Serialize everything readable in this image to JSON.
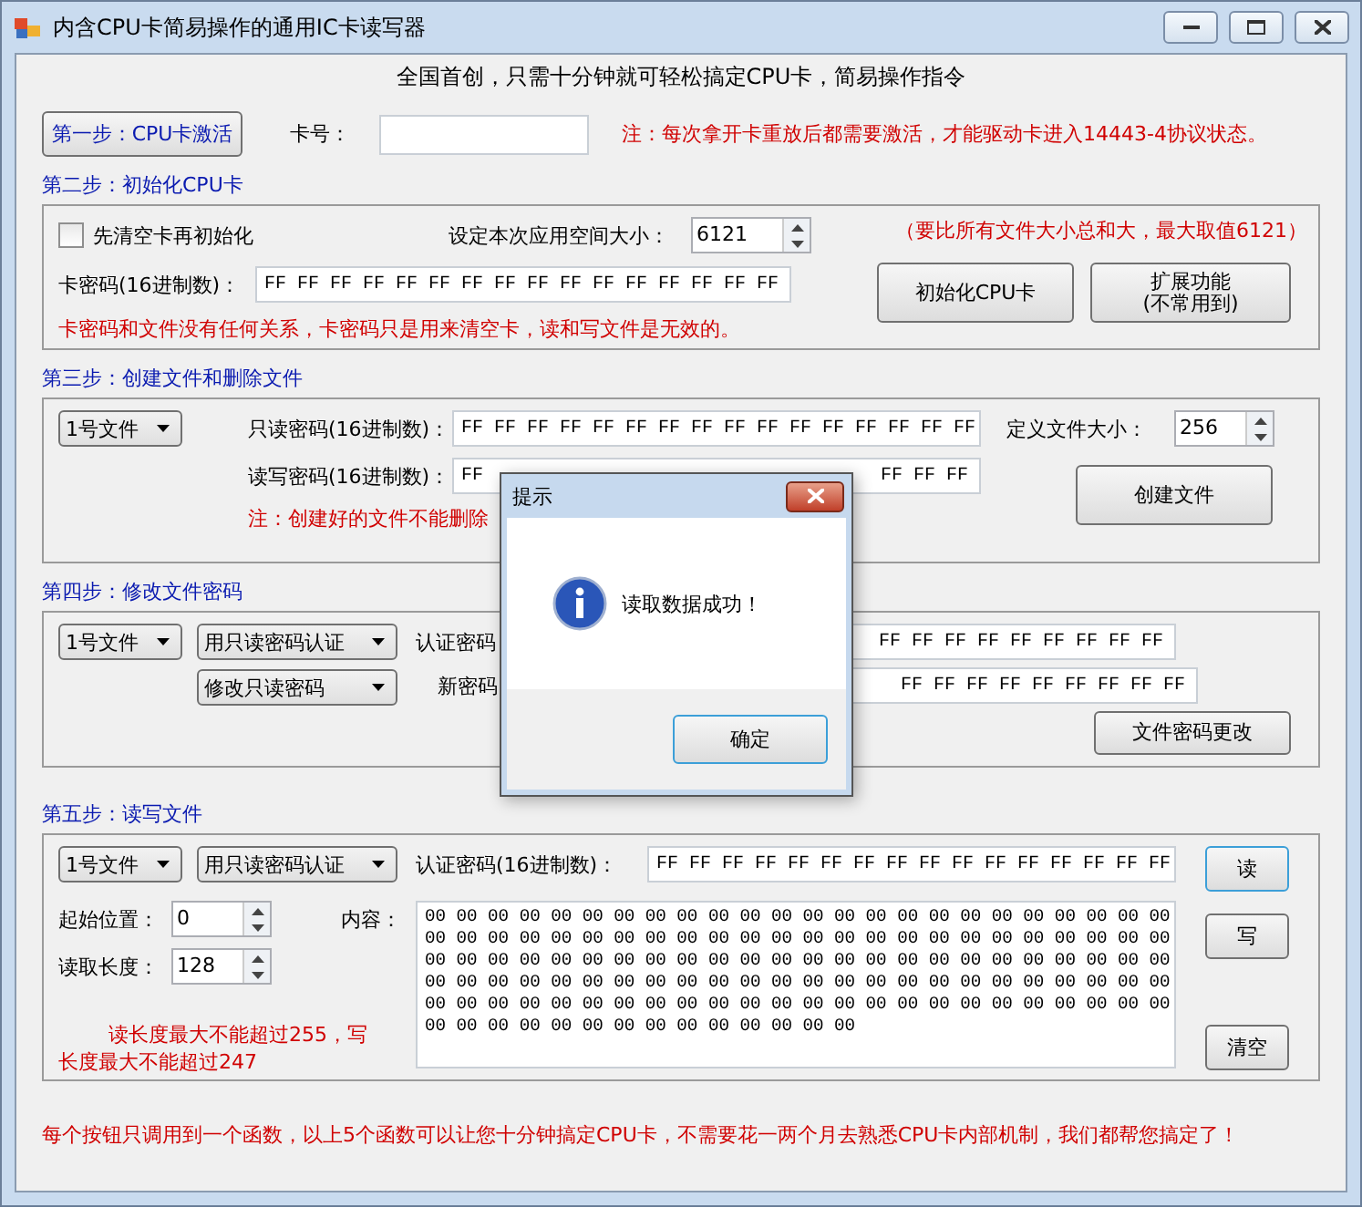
{
  "window": {
    "title": "内含CPU卡简易操作的通用IC卡读写器"
  },
  "subtitle": "全国首创，只需十分钟就可轻松搞定CPU卡，简易操作指令",
  "step1": {
    "button": "第一步：CPU卡激活",
    "card_label": "卡号：",
    "note": "注：每次拿开卡重放后都需要激活，才能驱动卡进入14443-4协议状态。"
  },
  "step2": {
    "title": "第二步：初始化CPU卡",
    "clear_checkbox": {
      "label": "先清空卡再初始化",
      "checked": false
    },
    "space_label": "设定本次应用空间大小：",
    "space_value": "6121",
    "space_note": "（要比所有文件大小总和大，最大取值6121）",
    "key_label": "卡密码(16进制数)：",
    "key_value": "FF FF FF FF FF FF FF FF FF FF FF FF FF FF FF FF",
    "note": "卡密码和文件没有任何关系，卡密码只是用来清空卡，读和写文件是无效的。",
    "init_button": "初始化CPU卡",
    "ext_button_lines": [
      "扩展功能",
      "(不常用到)"
    ]
  },
  "step3": {
    "title": "第三步：创建文件和删除文件",
    "file_select": "1号文件",
    "ro_label": "只读密码(16进制数)：",
    "ro_value": "FF FF FF FF FF FF FF FF FF FF FF FF FF FF FF FF",
    "rw_label": "读写密码(16进制数)：",
    "rw_value_start": "FF",
    "rw_value_end": "FF FF FF",
    "note": "注：创建好的文件不能删除",
    "size_label": "定义文件大小：",
    "size_value": "256",
    "button": "创建文件"
  },
  "step4": {
    "title": "第四步：修改文件密码",
    "file_select": "1号文件",
    "auth_select": "用只读密码认证",
    "target_select": "修改只读密码",
    "auth_label": "认证密码",
    "auth_value": "FF FF FF FF FF FF FF FF FF",
    "new_label": "新密码",
    "new_value": "FF FF FF FF FF FF FF FF FF",
    "button": "文件密码更改"
  },
  "step5": {
    "title": "第五步：读写文件",
    "file_select": "1号文件",
    "auth_select": "用只读密码认证",
    "auth_label": "认证密码(16进制数)：",
    "auth_value": "FF FF FF FF FF FF FF FF FF FF FF FF FF FF FF FF",
    "start_label": "起始位置：",
    "start_value": "0",
    "length_label": "读取长度：",
    "length_value": "128",
    "content_label": "内容：",
    "content": "00 00 00 00 00 00 00 00 00 00 00 00 00 00 00 00 00 00 00 00 00 00 00 00\n00 00 00 00 00 00 00 00 00 00 00 00 00 00 00 00 00 00 00 00 00 00 00 00\n00 00 00 00 00 00 00 00 00 00 00 00 00 00 00 00 00 00 00 00 00 00 00 00\n00 00 00 00 00 00 00 00 00 00 00 00 00 00 00 00 00 00 00 00 00 00 00 00\n00 00 00 00 00 00 00 00 00 00 00 00 00 00 00 00 00 00 00 00 00 00 00 00\n00 00 00 00 00 00 00 00 00 00 00 00 00 00",
    "note": "读长度最大不能超过255，写长度最大不能超过247",
    "read_button": "读",
    "write_button": "写",
    "clear_button": "清空"
  },
  "footer": "每个按钮只调用到一个函数，以上5个函数可以让您十分钟搞定CPU卡，不需要花一两个月去熟悉CPU卡内部机制，我们都帮您搞定了！",
  "dialog": {
    "title": "提示",
    "message": "读取数据成功！",
    "button": "确定"
  }
}
